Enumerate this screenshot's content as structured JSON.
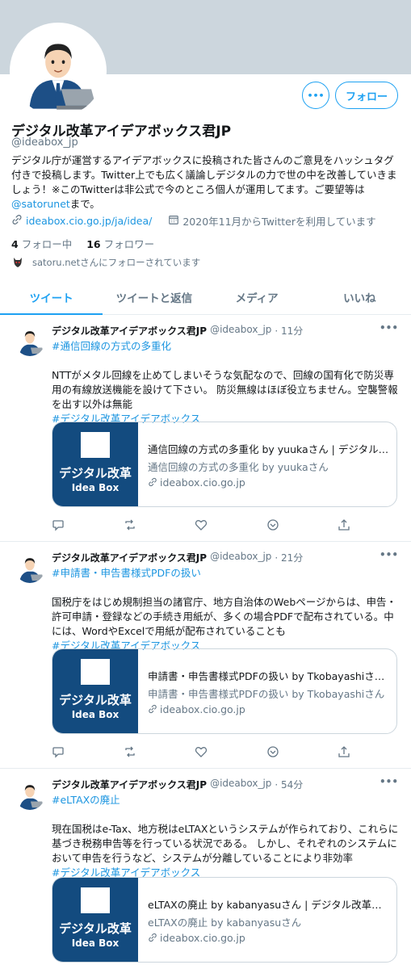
{
  "profile": {
    "name": "デジタル改革アイデアボックス君JP",
    "handle": "@ideabox_jp",
    "bio": "デジタル庁が運営するアイデアボックスに投稿された皆さんのご意見をハッシュタグ付きで投稿します。Twitter上でも広く議論しデジタルの力で世の中を改善していきましょう！※このTwitterは非公式で今のところ個人が運用してます。ご要望等は",
    "bio_mention": "@satorunet",
    "bio_end": "まで。",
    "link": "ideabox.cio.go.jp/ja/idea/",
    "joined": "2020年11月からTwitterを利用しています",
    "following_count": "4",
    "following_label": "フォロー中",
    "followers_count": "16",
    "followers_label": "フォロワー",
    "followed_by": "satoru.netさんにフォローされています",
    "follow_button": "フォロー",
    "more_button": "•••"
  },
  "tabs": [
    "ツイート",
    "ツイートと返信",
    "メディア",
    "いいね"
  ],
  "tweets": [
    {
      "name": "デジタル改革アイデアボックス君JP",
      "handle": "@ideabox_jp",
      "time": "· 11分",
      "hashtag1": "#通信回線の方式の多重化",
      "text": "NTTがメタル回線を止めてしまいそうな気配なので、回線の国有化で防災専用の有線放送機能を設けて下さい。 防災無線はほぼ役立ちません。空襲警報を出す以外は無能",
      "hashtag2": "#デジタル改革アイデアボックス",
      "card_title": "通信回線の方式の多重化 by yuukaさん | デジタル改...",
      "card_desc": "通信回線の方式の多重化 by yuukaさん",
      "card_url": "ideabox.cio.go.jp",
      "card_img_title": "デジタル改革",
      "card_img_sub": "Idea Box"
    },
    {
      "name": "デジタル改革アイデアボックス君JP",
      "handle": "@ideabox_jp",
      "time": "· 21分",
      "hashtag1": "#申請書・申告書様式PDFの扱い",
      "text": "国税庁をはじめ規制担当の諸官庁、地方自治体のWebページからは、申告・許可申請・登録などの手続き用紙が、多くの場合PDFで配布されている。中には、WordやExcelで用紙が配布されていることも",
      "hashtag2": "#デジタル改革アイデアボックス",
      "card_title": "申請書・申告書様式PDFの扱い by Tkobayashiさん | ...",
      "card_desc": "申請書・申告書様式PDFの扱い by Tkobayashiさん",
      "card_url": "ideabox.cio.go.jp",
      "card_img_title": "デジタル改革",
      "card_img_sub": "Idea Box"
    },
    {
      "name": "デジタル改革アイデアボックス君JP",
      "handle": "@ideabox_jp",
      "time": "· 54分",
      "hashtag1": "#eLTAXの廃止",
      "text": "現在国税はe-Tax、地方税はeLTAXというシステムが作られており、これらに基づき税務申告等を行っている状況である。 しかし、それぞれのシステムにおいて申告を行うなど、システムが分離していることにより非効率",
      "hashtag2": "#デジタル改革アイデアボックス",
      "card_title": "eLTAXの廃止 by kabanyasuさん | デジタル改革アイ...",
      "card_desc": "eLTAXの廃止 by kabanyasuさん",
      "card_url": "ideabox.cio.go.jp",
      "card_img_title": "デジタル改革",
      "card_img_sub": "Idea Box"
    }
  ],
  "colors": {
    "accent": "#1da1f2",
    "link": "#1b95e0",
    "banner": "#ccd6dd",
    "card_bg": "#134b7f"
  },
  "icons": [
    "link-icon",
    "calendar-icon",
    "reply-icon",
    "retweet-icon",
    "like-icon",
    "dm-icon",
    "share-icon",
    "more-icon"
  ]
}
